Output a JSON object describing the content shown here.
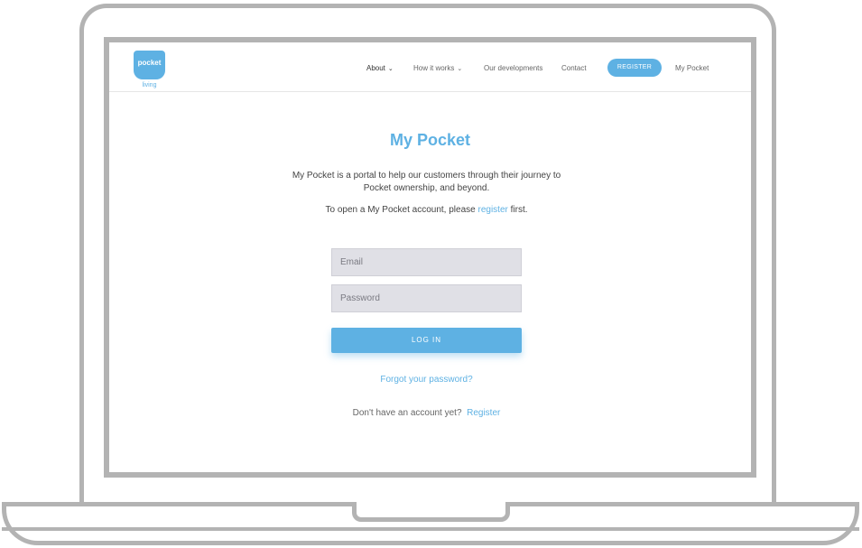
{
  "header": {
    "logo_text": "pocket",
    "logo_sub": "living",
    "nav": {
      "about": "About",
      "how_it_works": "How it works",
      "developments": "Our developments",
      "contact": "Contact",
      "register": "REGISTER",
      "my_pocket": "My Pocket"
    }
  },
  "main": {
    "title": "My Pocket",
    "intro": "My Pocket is a portal to help our customers through their journey to Pocket ownership, and beyond.",
    "open_prefix": "To open a My Pocket account, please",
    "open_link": "register",
    "open_suffix": "first.",
    "email_placeholder": "Email",
    "password_placeholder": "Password",
    "login_label": "LOG IN",
    "forgot_link": "Forgot your password?",
    "no_account_text": "Don't have an account yet?",
    "register_link": "Register"
  },
  "colors": {
    "accent": "#5eb1e3",
    "field_bg": "#e0e0e6",
    "frame": "#b3b3b3"
  }
}
